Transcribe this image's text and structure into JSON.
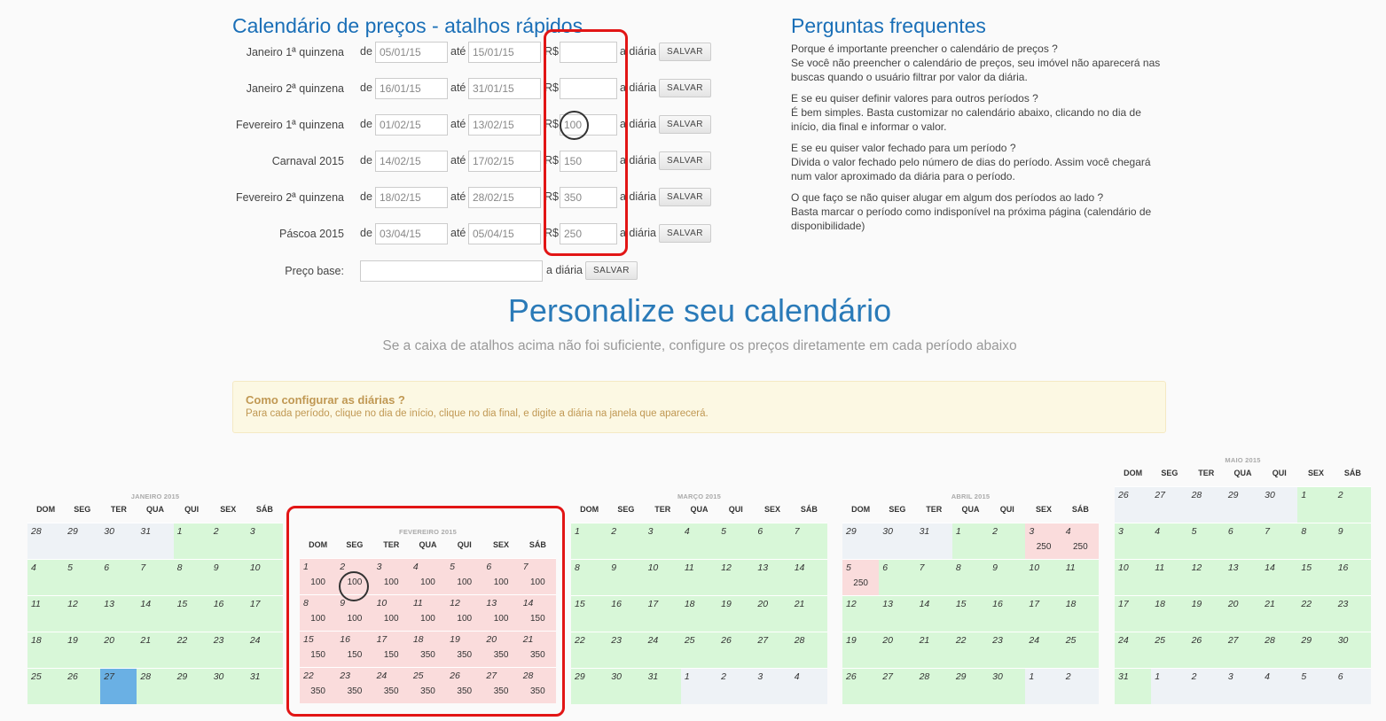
{
  "shortcuts": {
    "title": "Calendário de preços - atalhos rápidos",
    "de": "de",
    "ate": "até",
    "currency": "R$",
    "per_day": "a diária",
    "save": "SALVAR",
    "rows": [
      {
        "label": "Janeiro 1ª quinzena",
        "from": "05/01/15",
        "to": "15/01/15",
        "price": ""
      },
      {
        "label": "Janeiro 2ª quinzena",
        "from": "16/01/15",
        "to": "31/01/15",
        "price": ""
      },
      {
        "label": "Fevereiro 1ª quinzena",
        "from": "01/02/15",
        "to": "13/02/15",
        "price": "100"
      },
      {
        "label": "Carnaval 2015",
        "from": "14/02/15",
        "to": "17/02/15",
        "price": "150"
      },
      {
        "label": "Fevereiro 2ª quinzena",
        "from": "18/02/15",
        "to": "28/02/15",
        "price": "350"
      },
      {
        "label": "Páscoa 2015",
        "from": "03/04/15",
        "to": "05/04/15",
        "price": "250"
      }
    ],
    "base_price_label": "Preço base:",
    "base_price_value": ""
  },
  "faq": {
    "title": "Perguntas frequentes",
    "items": [
      {
        "q": "Porque é importante preencher o calendário de preços ?",
        "a": "Se você não preencher o calendário de preços, seu imóvel não aparecerá nas buscas quando o usuário filtrar por valor da diária."
      },
      {
        "q": "E se eu quiser definir valores para outros períodos ?",
        "a": "É bem simples. Basta customizar no calendário abaixo, clicando no dia de início, dia final e informar o valor."
      },
      {
        "q": "E se eu quiser valor fechado para um período ?",
        "a": "Divida o valor fechado pelo número de dias do período. Assim você chegará num valor aproximado da diária para o período."
      },
      {
        "q": "O que faço se não quiser alugar em algum dos períodos ao lado ?",
        "a": "Basta marcar o período como indisponível na próxima página (calendário de disponibilidade)"
      }
    ]
  },
  "personalize": {
    "title": "Personalize seu calendário",
    "subtitle": "Se a caixa de atalhos acima não foi suficiente, configure os preços diretamente em cada período abaixo"
  },
  "howto": {
    "title": "Como configurar as diárias ?",
    "text": "Para cada período, clique no dia de início, clique no dia final, e digite a diária na janela que aparecerá."
  },
  "weekdays": [
    "DOM",
    "SEG",
    "TER",
    "QUA",
    "QUI",
    "SEX",
    "SÁB"
  ],
  "calendars": [
    {
      "month": "JANEIRO 2015",
      "weeks": [
        [
          {
            "d": "28",
            "s": "other"
          },
          {
            "d": "29",
            "s": "other"
          },
          {
            "d": "30",
            "s": "other"
          },
          {
            "d": "31",
            "s": "other"
          },
          {
            "d": "1",
            "s": "green"
          },
          {
            "d": "2",
            "s": "green"
          },
          {
            "d": "3",
            "s": "green"
          }
        ],
        [
          {
            "d": "4",
            "s": "green"
          },
          {
            "d": "5",
            "s": "green"
          },
          {
            "d": "6",
            "s": "green"
          },
          {
            "d": "7",
            "s": "green"
          },
          {
            "d": "8",
            "s": "green"
          },
          {
            "d": "9",
            "s": "green"
          },
          {
            "d": "10",
            "s": "green"
          }
        ],
        [
          {
            "d": "11",
            "s": "green"
          },
          {
            "d": "12",
            "s": "green"
          },
          {
            "d": "13",
            "s": "green"
          },
          {
            "d": "14",
            "s": "green"
          },
          {
            "d": "15",
            "s": "green"
          },
          {
            "d": "16",
            "s": "green"
          },
          {
            "d": "17",
            "s": "green"
          }
        ],
        [
          {
            "d": "18",
            "s": "green"
          },
          {
            "d": "19",
            "s": "green"
          },
          {
            "d": "20",
            "s": "green"
          },
          {
            "d": "21",
            "s": "green"
          },
          {
            "d": "22",
            "s": "green"
          },
          {
            "d": "23",
            "s": "green"
          },
          {
            "d": "24",
            "s": "green"
          }
        ],
        [
          {
            "d": "25",
            "s": "green"
          },
          {
            "d": "26",
            "s": "green"
          },
          {
            "d": "27",
            "s": "today"
          },
          {
            "d": "28",
            "s": "green"
          },
          {
            "d": "29",
            "s": "green"
          },
          {
            "d": "30",
            "s": "green"
          },
          {
            "d": "31",
            "s": "green"
          }
        ]
      ]
    },
    {
      "month": "FEVEREIRO 2015",
      "weeks": [
        [
          {
            "d": "1",
            "s": "pink",
            "p": "100"
          },
          {
            "d": "2",
            "s": "pink",
            "p": "100"
          },
          {
            "d": "3",
            "s": "pink",
            "p": "100"
          },
          {
            "d": "4",
            "s": "pink",
            "p": "100"
          },
          {
            "d": "5",
            "s": "pink",
            "p": "100"
          },
          {
            "d": "6",
            "s": "pink",
            "p": "100"
          },
          {
            "d": "7",
            "s": "pink",
            "p": "100"
          }
        ],
        [
          {
            "d": "8",
            "s": "pink",
            "p": "100"
          },
          {
            "d": "9",
            "s": "pink",
            "p": "100"
          },
          {
            "d": "10",
            "s": "pink",
            "p": "100"
          },
          {
            "d": "11",
            "s": "pink",
            "p": "100"
          },
          {
            "d": "12",
            "s": "pink",
            "p": "100"
          },
          {
            "d": "13",
            "s": "pink",
            "p": "100"
          },
          {
            "d": "14",
            "s": "pink",
            "p": "150"
          }
        ],
        [
          {
            "d": "15",
            "s": "pink",
            "p": "150"
          },
          {
            "d": "16",
            "s": "pink",
            "p": "150"
          },
          {
            "d": "17",
            "s": "pink",
            "p": "150"
          },
          {
            "d": "18",
            "s": "pink",
            "p": "350"
          },
          {
            "d": "19",
            "s": "pink",
            "p": "350"
          },
          {
            "d": "20",
            "s": "pink",
            "p": "350"
          },
          {
            "d": "21",
            "s": "pink",
            "p": "350"
          }
        ],
        [
          {
            "d": "22",
            "s": "pink",
            "p": "350"
          },
          {
            "d": "23",
            "s": "pink",
            "p": "350"
          },
          {
            "d": "24",
            "s": "pink",
            "p": "350"
          },
          {
            "d": "25",
            "s": "pink",
            "p": "350"
          },
          {
            "d": "26",
            "s": "pink",
            "p": "350"
          },
          {
            "d": "27",
            "s": "pink",
            "p": "350"
          },
          {
            "d": "28",
            "s": "pink",
            "p": "350"
          }
        ]
      ]
    },
    {
      "month": "MARÇO 2015",
      "weeks": [
        [
          {
            "d": "1",
            "s": "green"
          },
          {
            "d": "2",
            "s": "green"
          },
          {
            "d": "3",
            "s": "green"
          },
          {
            "d": "4",
            "s": "green"
          },
          {
            "d": "5",
            "s": "green"
          },
          {
            "d": "6",
            "s": "green"
          },
          {
            "d": "7",
            "s": "green"
          }
        ],
        [
          {
            "d": "8",
            "s": "green"
          },
          {
            "d": "9",
            "s": "green"
          },
          {
            "d": "10",
            "s": "green"
          },
          {
            "d": "11",
            "s": "green"
          },
          {
            "d": "12",
            "s": "green"
          },
          {
            "d": "13",
            "s": "green"
          },
          {
            "d": "14",
            "s": "green"
          }
        ],
        [
          {
            "d": "15",
            "s": "green"
          },
          {
            "d": "16",
            "s": "green"
          },
          {
            "d": "17",
            "s": "green"
          },
          {
            "d": "18",
            "s": "green"
          },
          {
            "d": "19",
            "s": "green"
          },
          {
            "d": "20",
            "s": "green"
          },
          {
            "d": "21",
            "s": "green"
          }
        ],
        [
          {
            "d": "22",
            "s": "green"
          },
          {
            "d": "23",
            "s": "green"
          },
          {
            "d": "24",
            "s": "green"
          },
          {
            "d": "25",
            "s": "green"
          },
          {
            "d": "26",
            "s": "green"
          },
          {
            "d": "27",
            "s": "green"
          },
          {
            "d": "28",
            "s": "green"
          }
        ],
        [
          {
            "d": "29",
            "s": "green"
          },
          {
            "d": "30",
            "s": "green"
          },
          {
            "d": "31",
            "s": "green"
          },
          {
            "d": "1",
            "s": "other"
          },
          {
            "d": "2",
            "s": "other"
          },
          {
            "d": "3",
            "s": "other"
          },
          {
            "d": "4",
            "s": "other"
          }
        ]
      ]
    },
    {
      "month": "ABRIL 2015",
      "weeks": [
        [
          {
            "d": "29",
            "s": "other"
          },
          {
            "d": "30",
            "s": "other"
          },
          {
            "d": "31",
            "s": "other"
          },
          {
            "d": "1",
            "s": "green"
          },
          {
            "d": "2",
            "s": "green"
          },
          {
            "d": "3",
            "s": "pink",
            "p": "250"
          },
          {
            "d": "4",
            "s": "pink",
            "p": "250"
          }
        ],
        [
          {
            "d": "5",
            "s": "pink",
            "p": "250"
          },
          {
            "d": "6",
            "s": "green"
          },
          {
            "d": "7",
            "s": "green"
          },
          {
            "d": "8",
            "s": "green"
          },
          {
            "d": "9",
            "s": "green"
          },
          {
            "d": "10",
            "s": "green"
          },
          {
            "d": "11",
            "s": "green"
          }
        ],
        [
          {
            "d": "12",
            "s": "green"
          },
          {
            "d": "13",
            "s": "green"
          },
          {
            "d": "14",
            "s": "green"
          },
          {
            "d": "15",
            "s": "green"
          },
          {
            "d": "16",
            "s": "green"
          },
          {
            "d": "17",
            "s": "green"
          },
          {
            "d": "18",
            "s": "green"
          }
        ],
        [
          {
            "d": "19",
            "s": "green"
          },
          {
            "d": "20",
            "s": "green"
          },
          {
            "d": "21",
            "s": "green"
          },
          {
            "d": "22",
            "s": "green"
          },
          {
            "d": "23",
            "s": "green"
          },
          {
            "d": "24",
            "s": "green"
          },
          {
            "d": "25",
            "s": "green"
          }
        ],
        [
          {
            "d": "26",
            "s": "green"
          },
          {
            "d": "27",
            "s": "green"
          },
          {
            "d": "28",
            "s": "green"
          },
          {
            "d": "29",
            "s": "green"
          },
          {
            "d": "30",
            "s": "green"
          },
          {
            "d": "1",
            "s": "other"
          },
          {
            "d": "2",
            "s": "other"
          }
        ]
      ]
    },
    {
      "month": "MAIO 2015",
      "weeks": [
        [
          {
            "d": "26",
            "s": "other"
          },
          {
            "d": "27",
            "s": "other"
          },
          {
            "d": "28",
            "s": "other"
          },
          {
            "d": "29",
            "s": "other"
          },
          {
            "d": "30",
            "s": "other"
          },
          {
            "d": "1",
            "s": "green"
          },
          {
            "d": "2",
            "s": "green"
          }
        ],
        [
          {
            "d": "3",
            "s": "green"
          },
          {
            "d": "4",
            "s": "green"
          },
          {
            "d": "5",
            "s": "green"
          },
          {
            "d": "6",
            "s": "green"
          },
          {
            "d": "7",
            "s": "green"
          },
          {
            "d": "8",
            "s": "green"
          },
          {
            "d": "9",
            "s": "green"
          }
        ],
        [
          {
            "d": "10",
            "s": "green"
          },
          {
            "d": "11",
            "s": "green"
          },
          {
            "d": "12",
            "s": "green"
          },
          {
            "d": "13",
            "s": "green"
          },
          {
            "d": "14",
            "s": "green"
          },
          {
            "d": "15",
            "s": "green"
          },
          {
            "d": "16",
            "s": "green"
          }
        ],
        [
          {
            "d": "17",
            "s": "green"
          },
          {
            "d": "18",
            "s": "green"
          },
          {
            "d": "19",
            "s": "green"
          },
          {
            "d": "20",
            "s": "green"
          },
          {
            "d": "21",
            "s": "green"
          },
          {
            "d": "22",
            "s": "green"
          },
          {
            "d": "23",
            "s": "green"
          }
        ],
        [
          {
            "d": "24",
            "s": "green"
          },
          {
            "d": "25",
            "s": "green"
          },
          {
            "d": "26",
            "s": "green"
          },
          {
            "d": "27",
            "s": "green"
          },
          {
            "d": "28",
            "s": "green"
          },
          {
            "d": "29",
            "s": "green"
          },
          {
            "d": "30",
            "s": "green"
          }
        ],
        [
          {
            "d": "31",
            "s": "green"
          },
          {
            "d": "1",
            "s": "other"
          },
          {
            "d": "2",
            "s": "other"
          },
          {
            "d": "3",
            "s": "other"
          },
          {
            "d": "4",
            "s": "other"
          },
          {
            "d": "5",
            "s": "other"
          },
          {
            "d": "6",
            "s": "other"
          }
        ]
      ]
    }
  ],
  "colors": {
    "available": "#d8f7d8",
    "priced": "#fadcdc",
    "other_month": "#eef2f6",
    "today": "#6ab0e4",
    "highlight": "#e21515",
    "title_blue": "#1a6fb7"
  }
}
